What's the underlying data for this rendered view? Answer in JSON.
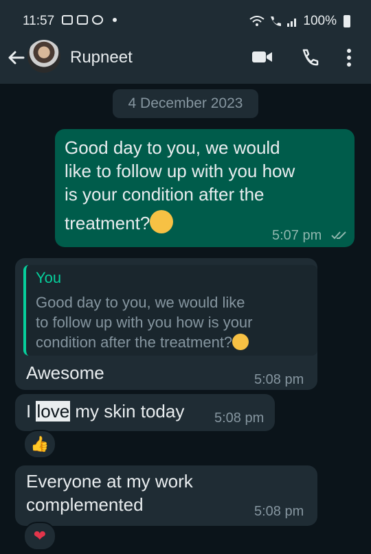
{
  "status_bar": {
    "time": "11:57",
    "battery": "100%"
  },
  "header": {
    "contact_name": "Rupneet"
  },
  "chat": {
    "date_label": "4 December 2023",
    "messages": [
      {
        "direction": "out",
        "text_lines": [
          "Good day to you, we would",
          "like to follow up with you how",
          "is your condition after the",
          "treatment?"
        ],
        "time": "5:07 pm"
      },
      {
        "direction": "in",
        "quoted_author": "You",
        "quoted_lines": [
          "Good day to you, we would like",
          "to follow up with you how is your",
          "condition after the treatment?"
        ],
        "text": "Awesome",
        "time": "5:08 pm"
      },
      {
        "direction": "in",
        "text_before": "I ",
        "text_highlight": "love",
        "text_after": " my skin today",
        "time": "5:08 pm",
        "reaction": "👍"
      },
      {
        "direction": "in",
        "text_lines": [
          "Everyone at my work",
          "complemented"
        ],
        "time": "5:08 pm",
        "reaction": "❤"
      }
    ]
  },
  "colors": {
    "outgoing": "#005c4b",
    "incoming": "#1f2c34",
    "background": "#0b141a",
    "accent": "#06cf9c"
  }
}
